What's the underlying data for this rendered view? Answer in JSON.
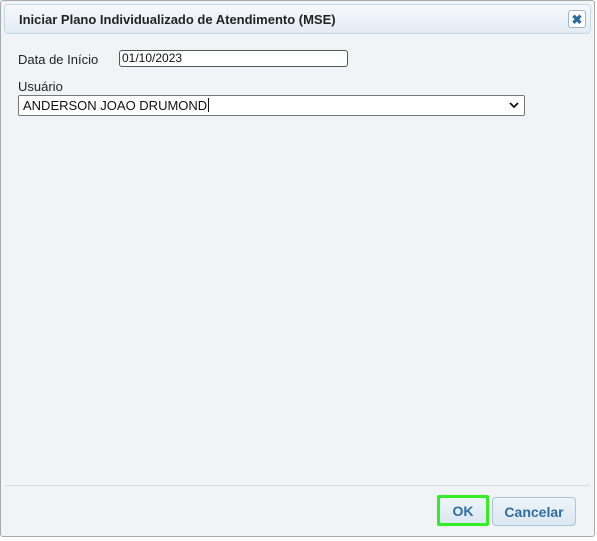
{
  "dialog": {
    "title": "Iniciar Plano Individualizado de Atendimento (MSE)",
    "close_icon": "close-icon"
  },
  "form": {
    "start_date_label": "Data de Início",
    "start_date_value": "01/10/2023",
    "user_label": "Usuário",
    "user_selected": "ANDERSON JOAO DRUMOND"
  },
  "buttons": {
    "ok_label": "OK",
    "cancel_label": "Cancelar"
  },
  "colors": {
    "accent": "#2e6da4",
    "focus_outline": "#33ee22",
    "panel_bg": "#f1f4f7"
  }
}
